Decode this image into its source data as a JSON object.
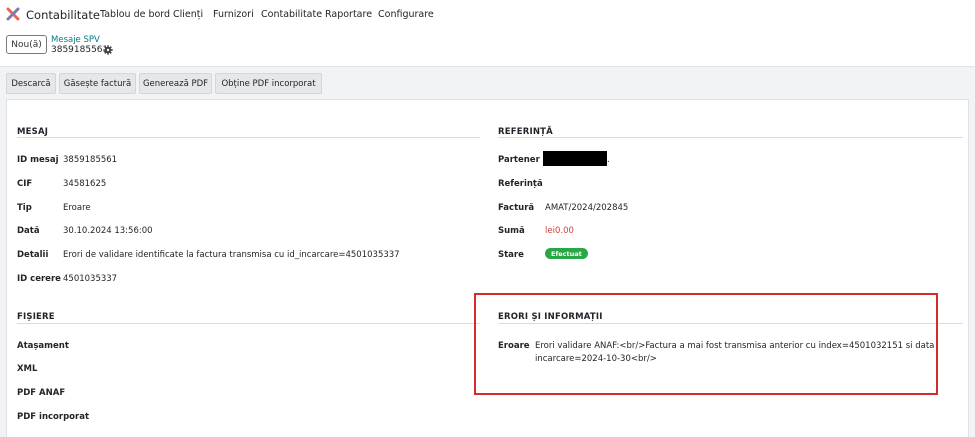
{
  "app": {
    "name": "Contabilitate",
    "menu": [
      "Tablou de bord",
      "Clienți",
      "Furnizori",
      "Contabilitate",
      "Raportare",
      "Configurare"
    ]
  },
  "controls": {
    "new_button": "Nou(ă)",
    "breadcrumb_parent": "Mesaje SPV",
    "record_id": "3859185561"
  },
  "actions": [
    "Descarcă",
    "Găsește factură",
    "Generează PDF",
    "Obține PDF incorporat"
  ],
  "mesaj": {
    "title": "MESAJ",
    "fields": [
      {
        "label": "ID mesaj",
        "value": "3859185561"
      },
      {
        "label": "CIF",
        "value": "34581625"
      },
      {
        "label": "Tip",
        "value": "Eroare"
      },
      {
        "label": "Dată",
        "value": "30.10.2024 13:56:00"
      },
      {
        "label": "Detalii",
        "value": "Erori de validare identificate la factura transmisa cu id_incarcare=4501035337"
      },
      {
        "label": "ID cerere",
        "value": "4501035337"
      }
    ]
  },
  "referinta": {
    "title": "REFERINȚĂ",
    "fields": [
      {
        "label": "Partener",
        "value": "."
      },
      {
        "label": "Referință",
        "value": ""
      },
      {
        "label": "Factură",
        "value": "AMAT/2024/202845"
      },
      {
        "label": "Sumă",
        "value": "lei0.00"
      },
      {
        "label": "Stare",
        "value": "Efectuat"
      }
    ]
  },
  "fisiere": {
    "title": "FIȘIERE",
    "fields": [
      "Atașament",
      "XML",
      "PDF ANAF",
      "PDF incorporat"
    ]
  },
  "erori": {
    "title": "ERORI ȘI INFORMAȚII",
    "label": "Eroare",
    "line1": "Erori validare ANAF:<br/>Factura a mai fost transmisa anterior cu index=4501032151 si data",
    "line2": "incarcare=2024-10-30<br/>"
  },
  "colors": {
    "accent": "#017e84",
    "brand_logo": [
      "#f06050",
      "#7c7bad"
    ],
    "status_success": "#28a745",
    "amount_red": "#d23f3a",
    "highlight_border": "#d22c2c"
  }
}
